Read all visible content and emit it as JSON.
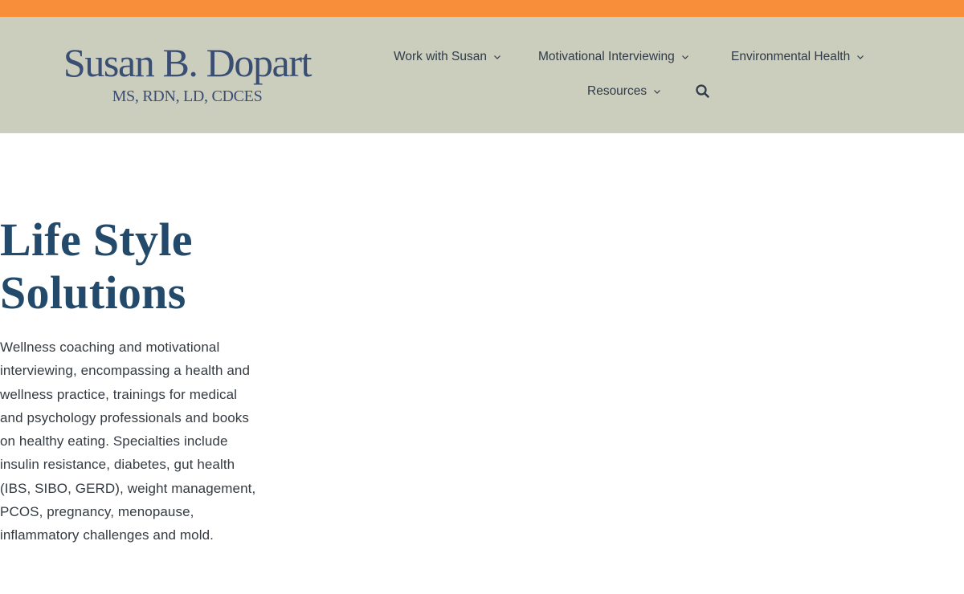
{
  "brand": {
    "name": "Susan B. Dopart",
    "credentials": "MS, RDN, LD, CDCES"
  },
  "nav": {
    "items": [
      {
        "label": "Work with Susan",
        "icon": "chevron-down-icon"
      },
      {
        "label": "Motivational Interviewing",
        "icon": "chevron-down-icon"
      },
      {
        "label": "Environmental Health",
        "icon": "chevron-down-icon"
      },
      {
        "label": "Resources",
        "icon": "chevron-down-icon"
      }
    ],
    "search_icon": "search-icon"
  },
  "hero": {
    "title_line1": "Life Style",
    "title_line2": "Solutions",
    "description": "Wellness coaching and motivational interviewing, encompassing a health and wellness practice, trainings for medical and psychology professionals and books on healthy eating. Specialties include insulin resistance, diabetes, gut health (IBS, SIBO, GERD), weight management, PCOS, pregnancy, menopause, inflammatory challenges and mold."
  },
  "colors": {
    "top_bar": "#f98e3a",
    "header_bg": "#cbcdbd",
    "logo_text": "#3a4d72",
    "title_text": "#234a6b",
    "nav_text": "#2f3b48"
  }
}
